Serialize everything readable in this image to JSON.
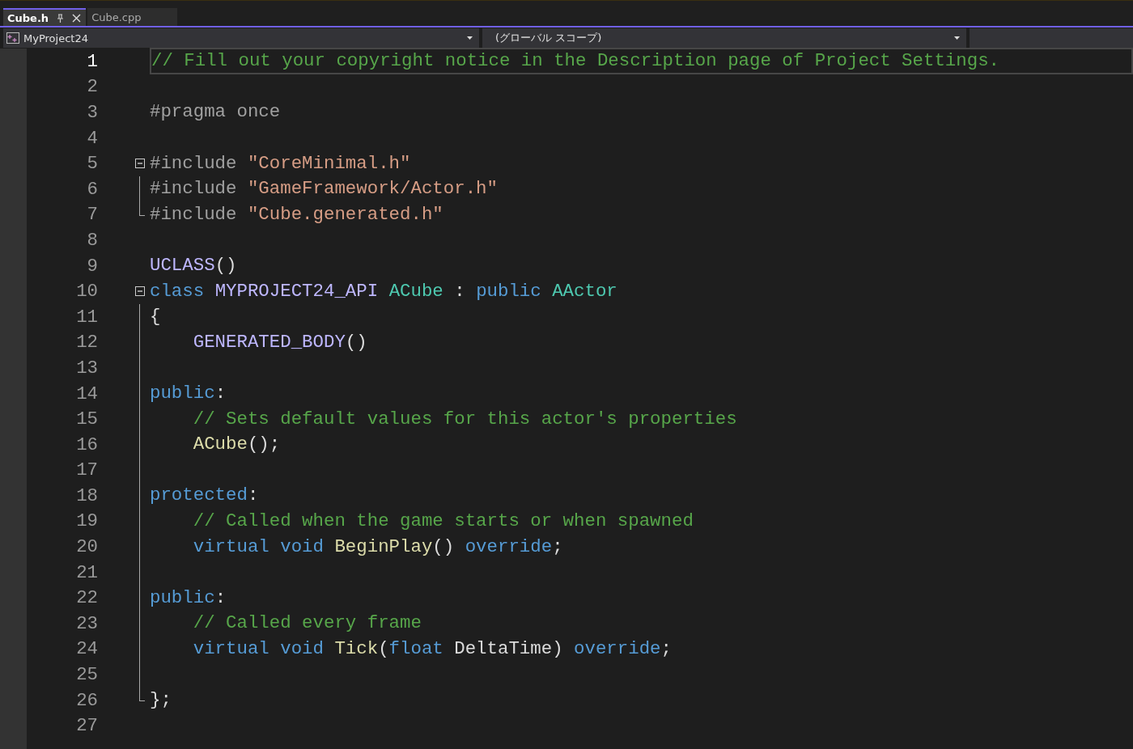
{
  "tabs": [
    {
      "label": "Cube.h",
      "selected": true,
      "pinned": true,
      "closable": true
    },
    {
      "label": "Cube.cpp",
      "selected": false,
      "pinned": false,
      "closable": false
    }
  ],
  "navigation_bar": {
    "project": "MyProject24",
    "scope": "(グローバル スコープ)"
  },
  "editor": {
    "lines": [
      {
        "number": "1",
        "current": true,
        "kind": "plain",
        "indented": false,
        "tokens": [
          {
            "text": "// Fill out your copyright notice in the Description page of Project Settings.",
            "kind": "comment"
          }
        ]
      },
      {
        "number": "2",
        "current": false,
        "kind": "plain"
      },
      {
        "number": "3",
        "current": false,
        "kind": "plain",
        "indented": false,
        "tokens": [
          {
            "text": "#pragma once",
            "kind": "preprocessor"
          }
        ]
      },
      {
        "number": "4",
        "current": false,
        "kind": "plain"
      },
      {
        "number": "5",
        "current": false,
        "kind": "collapsible",
        "indented": false,
        "tokens": [
          {
            "text": "#include ",
            "kind": "preprocessor"
          },
          {
            "text": "\"CoreMinimal.h\"",
            "kind": "string"
          }
        ]
      },
      {
        "number": "6",
        "current": false,
        "kind": "guided",
        "indented": false,
        "tokens": [
          {
            "text": "#include ",
            "kind": "preprocessor"
          },
          {
            "text": "\"GameFramework/Actor.h\"",
            "kind": "string"
          }
        ]
      },
      {
        "number": "7",
        "current": false,
        "kind": "guideend",
        "indented": false,
        "tokens": [
          {
            "text": "#include ",
            "kind": "preprocessor"
          },
          {
            "text": "\"Cube.generated.h\"",
            "kind": "string"
          }
        ]
      },
      {
        "number": "8",
        "current": false,
        "kind": "plain"
      },
      {
        "number": "9",
        "current": false,
        "kind": "plain",
        "indented": false,
        "tokens": [
          {
            "text": "UCLASS",
            "kind": "macro"
          },
          {
            "text": "()",
            "kind": "plain"
          }
        ]
      },
      {
        "number": "10",
        "current": false,
        "kind": "collapsible",
        "indented": false,
        "tokens": [
          {
            "text": "class ",
            "kind": "keyword"
          },
          {
            "text": "MYPROJECT24_API ",
            "kind": "macro"
          },
          {
            "text": "ACube",
            "kind": "type"
          },
          {
            "text": " : ",
            "kind": "plain"
          },
          {
            "text": "public ",
            "kind": "keyword"
          },
          {
            "text": "AActor",
            "kind": "type"
          }
        ]
      },
      {
        "number": "11",
        "current": false,
        "kind": "guided",
        "indented": false,
        "tokens": [
          {
            "text": "{",
            "kind": "plain"
          }
        ]
      },
      {
        "number": "12",
        "current": false,
        "kind": "guided",
        "indented": true,
        "tokens": [
          {
            "text": "GENERATED_BODY",
            "kind": "macro"
          },
          {
            "text": "()",
            "kind": "plain"
          }
        ]
      },
      {
        "number": "13",
        "current": false,
        "kind": "guided"
      },
      {
        "number": "14",
        "current": false,
        "kind": "guided",
        "indented": false,
        "tokens": [
          {
            "text": "public",
            "kind": "keyword"
          },
          {
            "text": ":",
            "kind": "plain"
          }
        ]
      },
      {
        "number": "15",
        "current": false,
        "kind": "guided",
        "indented": true,
        "tokens": [
          {
            "text": "// Sets default values for this actor's properties",
            "kind": "comment"
          }
        ]
      },
      {
        "number": "16",
        "current": false,
        "kind": "guided",
        "indented": true,
        "tokens": [
          {
            "text": "ACube",
            "kind": "function"
          },
          {
            "text": "();",
            "kind": "plain"
          }
        ]
      },
      {
        "number": "17",
        "current": false,
        "kind": "guided"
      },
      {
        "number": "18",
        "current": false,
        "kind": "guided",
        "indented": false,
        "tokens": [
          {
            "text": "protected",
            "kind": "keyword"
          },
          {
            "text": ":",
            "kind": "plain"
          }
        ]
      },
      {
        "number": "19",
        "current": false,
        "kind": "guided",
        "indented": true,
        "tokens": [
          {
            "text": "// Called when the game starts or when spawned",
            "kind": "comment"
          }
        ]
      },
      {
        "number": "20",
        "current": false,
        "kind": "guided",
        "indented": true,
        "tokens": [
          {
            "text": "virtual void ",
            "kind": "keyword"
          },
          {
            "text": "BeginPlay",
            "kind": "function"
          },
          {
            "text": "() ",
            "kind": "plain"
          },
          {
            "text": "override",
            "kind": "keyword"
          },
          {
            "text": ";",
            "kind": "plain"
          }
        ]
      },
      {
        "number": "21",
        "current": false,
        "kind": "guided"
      },
      {
        "number": "22",
        "current": false,
        "kind": "guided",
        "indented": false,
        "tokens": [
          {
            "text": "public",
            "kind": "keyword"
          },
          {
            "text": ":",
            "kind": "plain"
          }
        ]
      },
      {
        "number": "23",
        "current": false,
        "kind": "guided",
        "indented": true,
        "tokens": [
          {
            "text": "// Called every frame",
            "kind": "comment"
          }
        ]
      },
      {
        "number": "24",
        "current": false,
        "kind": "guided",
        "indented": true,
        "tokens": [
          {
            "text": "virtual void ",
            "kind": "keyword"
          },
          {
            "text": "Tick",
            "kind": "function"
          },
          {
            "text": "(",
            "kind": "plain"
          },
          {
            "text": "float",
            "kind": "keyword"
          },
          {
            "text": " DeltaTime) ",
            "kind": "plain"
          },
          {
            "text": "override",
            "kind": "keyword"
          },
          {
            "text": ";",
            "kind": "plain"
          }
        ]
      },
      {
        "number": "25",
        "current": false,
        "kind": "guided"
      },
      {
        "number": "26",
        "current": false,
        "kind": "guideend",
        "indented": false,
        "tokens": [
          {
            "text": "};",
            "kind": "plain"
          }
        ]
      },
      {
        "number": "27",
        "current": false,
        "kind": "plain"
      }
    ]
  }
}
